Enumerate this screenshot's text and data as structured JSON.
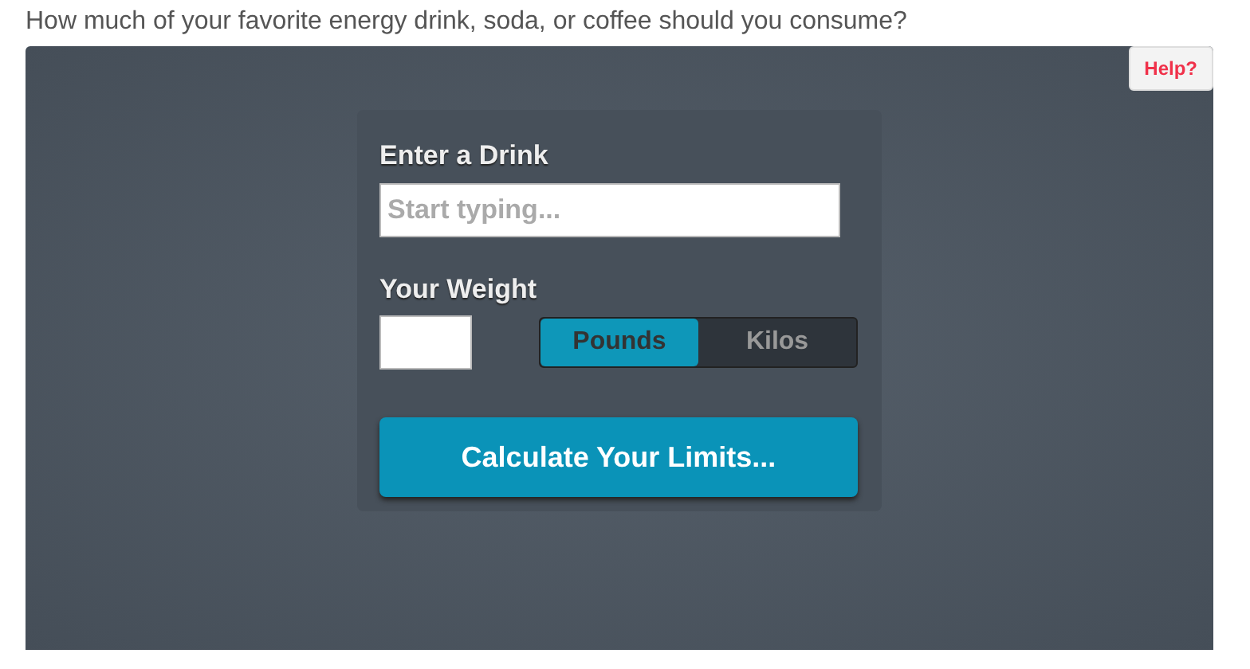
{
  "question": "How much of your favorite energy drink, soda, or coffee should you consume?",
  "help_button": "Help?",
  "drink": {
    "label": "Enter a Drink",
    "placeholder": "Start typing..."
  },
  "weight": {
    "label": "Your Weight",
    "units": [
      {
        "label": "Pounds",
        "selected": true
      },
      {
        "label": "Kilos",
        "selected": false
      }
    ]
  },
  "calculate_button": "Calculate Your Limits..."
}
